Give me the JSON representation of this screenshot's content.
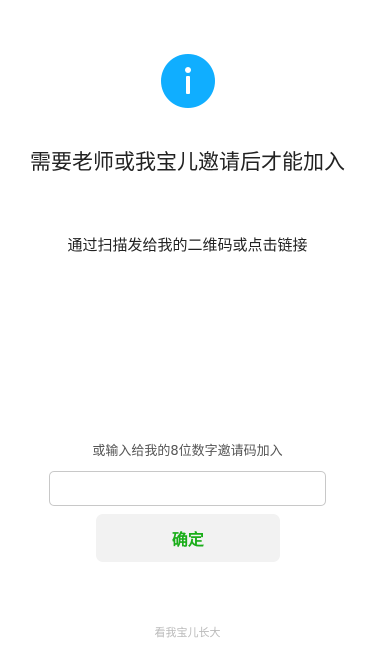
{
  "icon": {
    "name": "info-icon",
    "color": "#10aeff"
  },
  "title": "需要老师或我宝儿邀请后才能加入",
  "subtitle": "通过扫描发给我的二维码或点击链接",
  "code_entry": {
    "label": "或输入给我的8位数字邀请码加入",
    "value": "",
    "placeholder": ""
  },
  "confirm_button": {
    "label": "确定",
    "color": "#1aad19"
  },
  "footer": {
    "link_text": "看我宝儿长大"
  }
}
